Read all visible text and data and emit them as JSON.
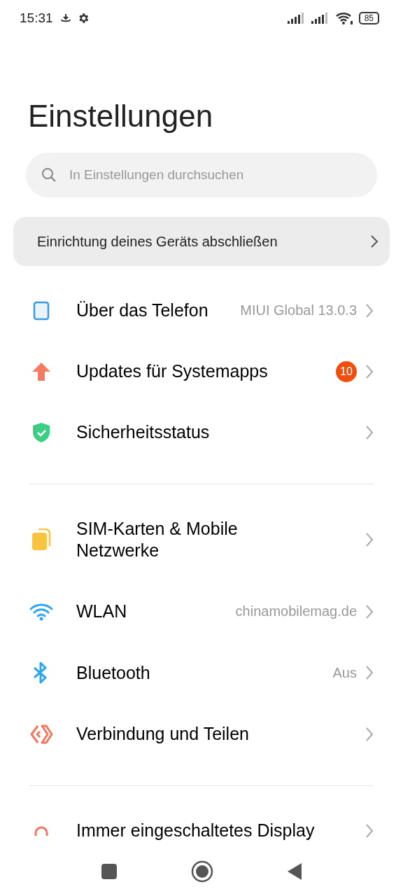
{
  "status_bar": {
    "time": "15:31",
    "battery": "85"
  },
  "title": "Einstellungen",
  "search": {
    "placeholder": "In Einstellungen durchsuchen"
  },
  "setup_card": {
    "label": "Einrichtung deines Geräts abschließen"
  },
  "sections": [
    {
      "items": [
        {
          "kind": "phone",
          "label": "Über das Telefon",
          "value": "MIUI Global 13.0.3"
        },
        {
          "kind": "update",
          "label": "Updates für Systemapps",
          "badge": "10"
        },
        {
          "kind": "security",
          "label": "Sicherheitsstatus"
        }
      ]
    },
    {
      "items": [
        {
          "kind": "sim",
          "label": "SIM-Karten & Mobile Netzwerke"
        },
        {
          "kind": "wifi",
          "label": "WLAN",
          "value": "chinamobilemag.de"
        },
        {
          "kind": "bluetooth",
          "label": "Bluetooth",
          "value": "Aus"
        },
        {
          "kind": "share",
          "label": "Verbindung und Teilen"
        }
      ]
    },
    {
      "items": [
        {
          "kind": "display",
          "label": "Immer eingeschaltetes Display"
        }
      ]
    }
  ]
}
